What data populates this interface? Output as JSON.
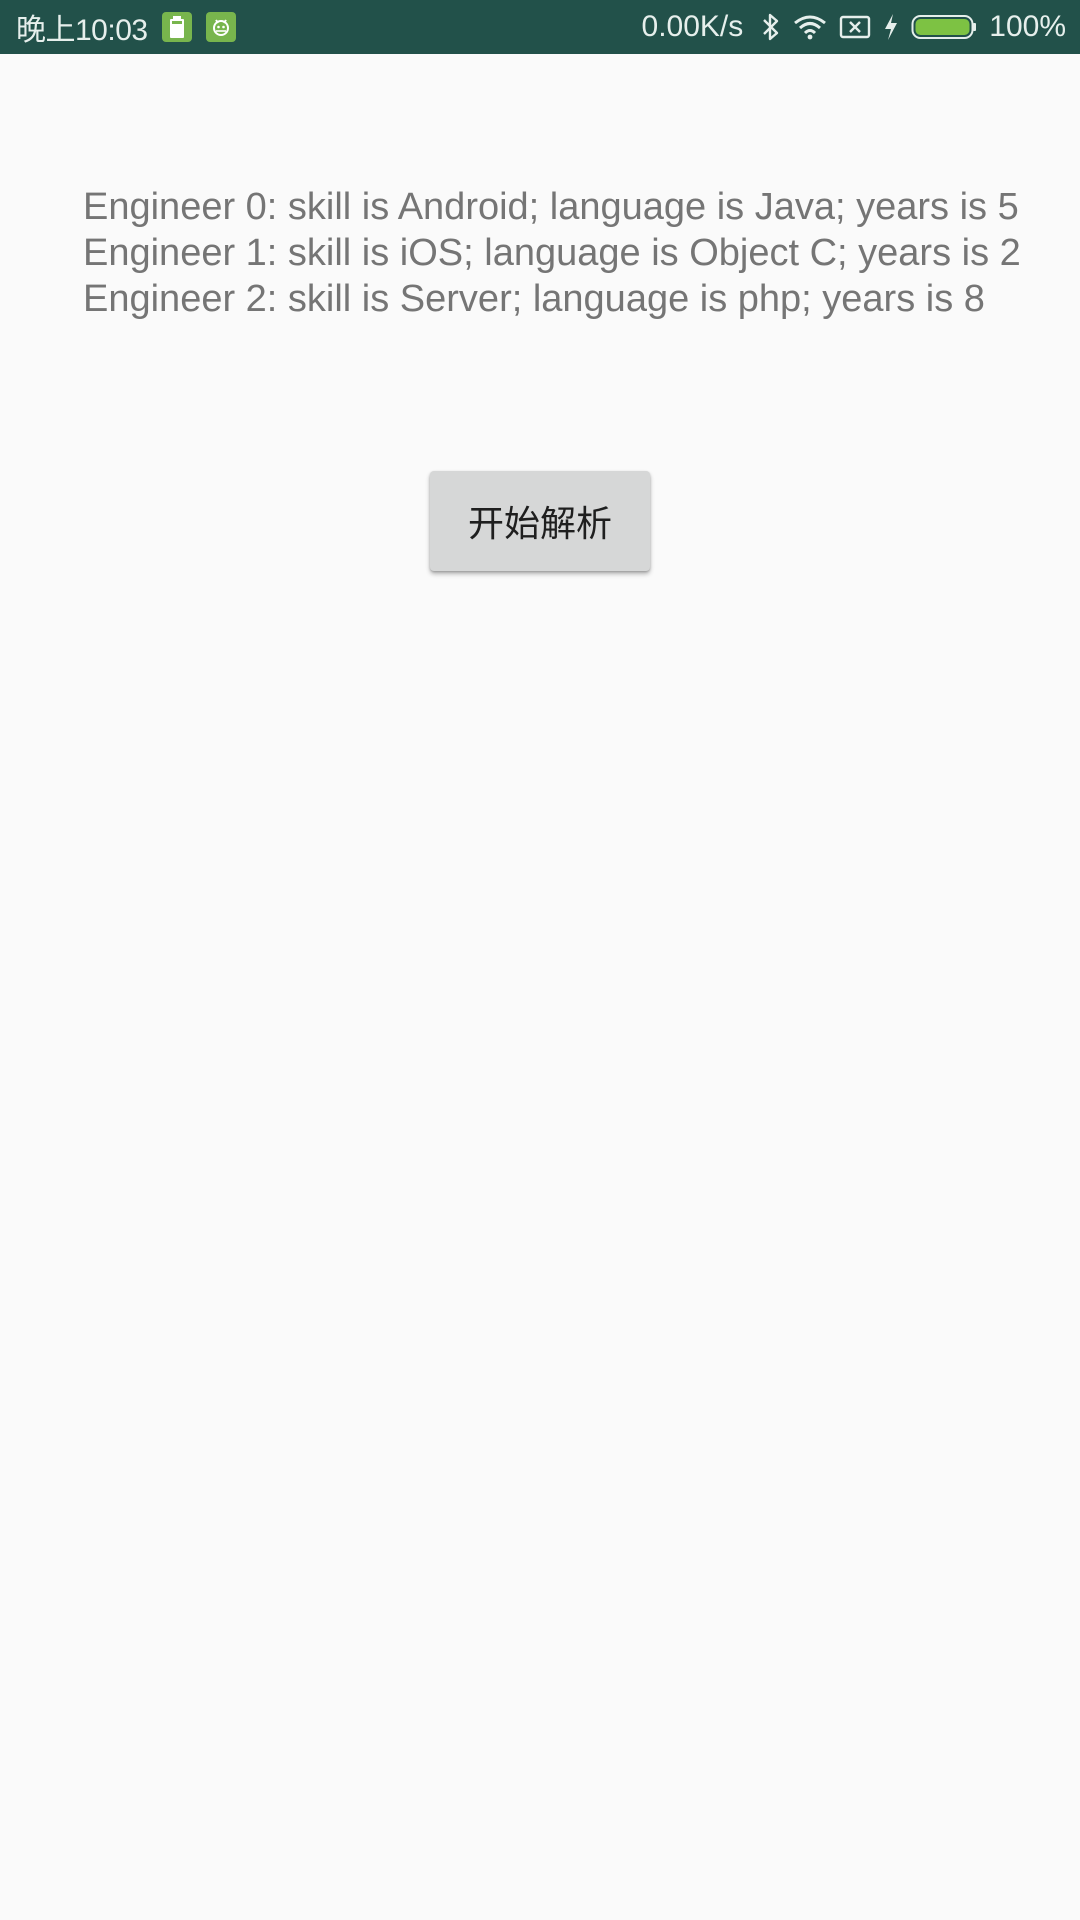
{
  "status_bar": {
    "time": "晚上10:03",
    "net_speed": "0.00K/s",
    "battery_percent": "100%",
    "battery_level": 1.0,
    "background_color": "#22514a",
    "icons": [
      "battery-saver-icon",
      "android-icon",
      "bluetooth-icon",
      "wifi-icon",
      "no-sim-icon",
      "charging-icon",
      "battery-icon"
    ]
  },
  "main": {
    "engineers": [
      "Engineer 0: skill is Android; language is Java; years is 5",
      "Engineer 1: skill is iOS; language is Object C; years is 2",
      "Engineer 2: skill is Server; language is php; years is 8"
    ],
    "parse_button_label": "开始解析"
  },
  "colors": {
    "background": "#fafafa",
    "text": "#757575",
    "button": "#d6d7d7",
    "battery_fill": "#7dc243"
  }
}
